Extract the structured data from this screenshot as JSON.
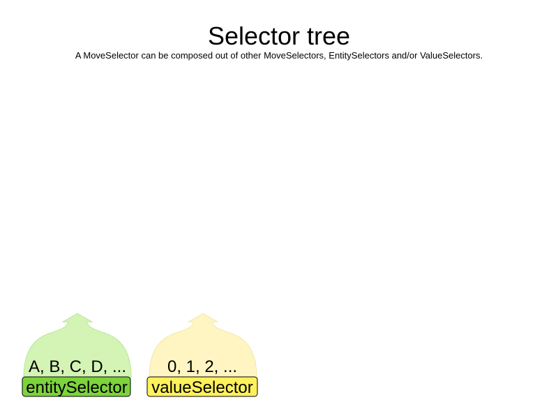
{
  "header": {
    "title": "Selector tree",
    "subtitle": "A MoveSelector can be composed out of other MoveSelectors, EntitySelectors and/or ValueSelectors."
  },
  "selectors": [
    {
      "id": "entity",
      "label": "entitySelector",
      "sample": "A, B, C, D, ...",
      "label_color": "#7dd33c",
      "cloud_color": "#d3f4b5",
      "cloud_stroke": "#b9e69a"
    },
    {
      "id": "value",
      "label": "valueSelector",
      "sample": "0, 1, 2, ...",
      "label_color": "#fff15c",
      "cloud_color": "#fff5c2",
      "cloud_stroke": "#f1e8a8"
    }
  ]
}
